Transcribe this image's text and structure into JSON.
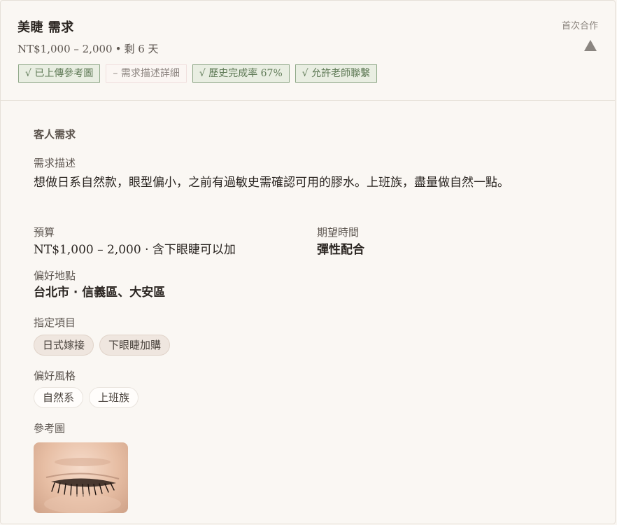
{
  "header": {
    "title": "美睫 需求",
    "meta_price": "NT$1,000 – 2,000",
    "meta_sep": "•",
    "meta_remaining": "剩 6 天",
    "first_cooperation": "首次合作",
    "collapse_icon": "triangle-up-icon"
  },
  "chips": [
    {
      "label": "√ 已上傳參考圖",
      "state": "on"
    },
    {
      "label": "– 需求描述詳細",
      "state": "off"
    },
    {
      "label": "√ 歷史完成率 67%",
      "state": "on"
    },
    {
      "label": "√ 允許老師聯繫",
      "state": "on"
    }
  ],
  "request": {
    "section_title": "客人需求",
    "description_label": "需求描述",
    "description": "想做日系自然款，眼型偏小，之前有過敏史需確認可用的膠水。上班族，盡量做自然一點。",
    "budget_label": "預算",
    "budget_value": "NT$1,000 – 2,000 · 含下眼睫可以加",
    "time_label": "期望時間",
    "time_value": "彈性配合",
    "location_label": "偏好地點",
    "location_value": "台北市 · 信義區、大安區",
    "items_label": "指定項目",
    "items": [
      "日式嫁接",
      "下眼睫加購"
    ],
    "style_label": "偏好風格",
    "styles": [
      "自然系",
      "上班族"
    ],
    "ref_label": "參考圖"
  },
  "colors": {
    "background": "#faf7f3",
    "chip_on_border": "#8fa888",
    "chip_on_text": "#5f7a56",
    "pill_tan": "#efe6df"
  }
}
